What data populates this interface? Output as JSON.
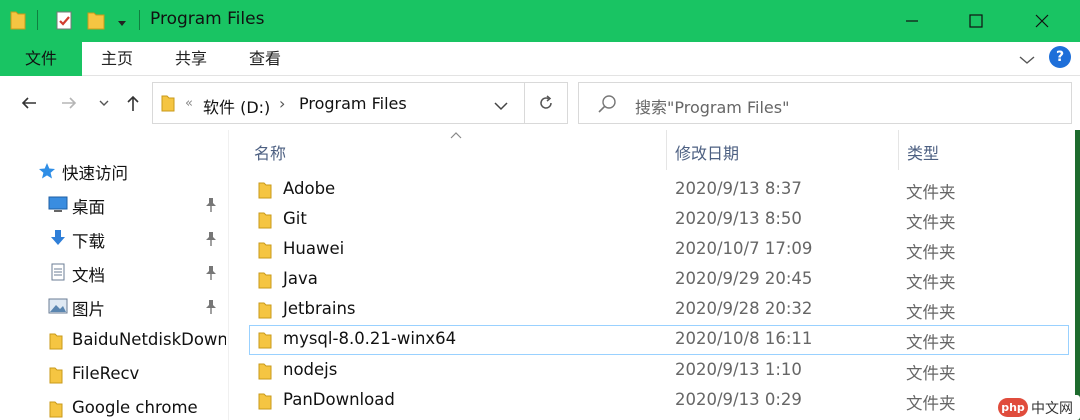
{
  "window": {
    "title": "Program Files",
    "accent": "#19c463"
  },
  "ribbon": {
    "tabs": [
      "文件",
      "主页",
      "共享",
      "查看"
    ],
    "help_label": "?"
  },
  "address": {
    "overflow": "«",
    "crumbs": [
      "软件 (D:)",
      "Program Files"
    ],
    "separator": "›"
  },
  "search": {
    "placeholder": "搜索\"Program Files\""
  },
  "nav": {
    "quick_access": "快速访问",
    "items": [
      {
        "label": "桌面",
        "icon": "desktop-icon",
        "pinned": true
      },
      {
        "label": "下载",
        "icon": "download-icon",
        "pinned": true
      },
      {
        "label": "文档",
        "icon": "document-icon",
        "pinned": true
      },
      {
        "label": "图片",
        "icon": "picture-icon",
        "pinned": true
      },
      {
        "label": "BaiduNetdiskDownload",
        "icon": "folder-icon",
        "pinned": false
      },
      {
        "label": "FileRecv",
        "icon": "folder-icon",
        "pinned": false
      },
      {
        "label": "Google chrome",
        "icon": "folder-icon",
        "pinned": false
      }
    ]
  },
  "columns": {
    "name": "名称",
    "date": "修改日期",
    "type": "类型"
  },
  "files": [
    {
      "name": "Adobe",
      "date": "2020/9/13 8:37",
      "type": "文件夹"
    },
    {
      "name": "Git",
      "date": "2020/9/13 8:50",
      "type": "文件夹"
    },
    {
      "name": "Huawei",
      "date": "2020/10/7 17:09",
      "type": "文件夹"
    },
    {
      "name": "Java",
      "date": "2020/9/29 20:45",
      "type": "文件夹"
    },
    {
      "name": "Jetbrains",
      "date": "2020/9/28 20:32",
      "type": "文件夹"
    },
    {
      "name": "mysql-8.0.21-winx64",
      "date": "2020/10/8 16:11",
      "type": "文件夹",
      "hovered": true
    },
    {
      "name": "nodejs",
      "date": "2020/9/13 1:10",
      "type": "文件夹"
    },
    {
      "name": "PanDownload",
      "date": "2020/9/13 0:29",
      "type": "文件夹"
    }
  ],
  "watermark": {
    "badge": "php",
    "text": "中文网"
  }
}
